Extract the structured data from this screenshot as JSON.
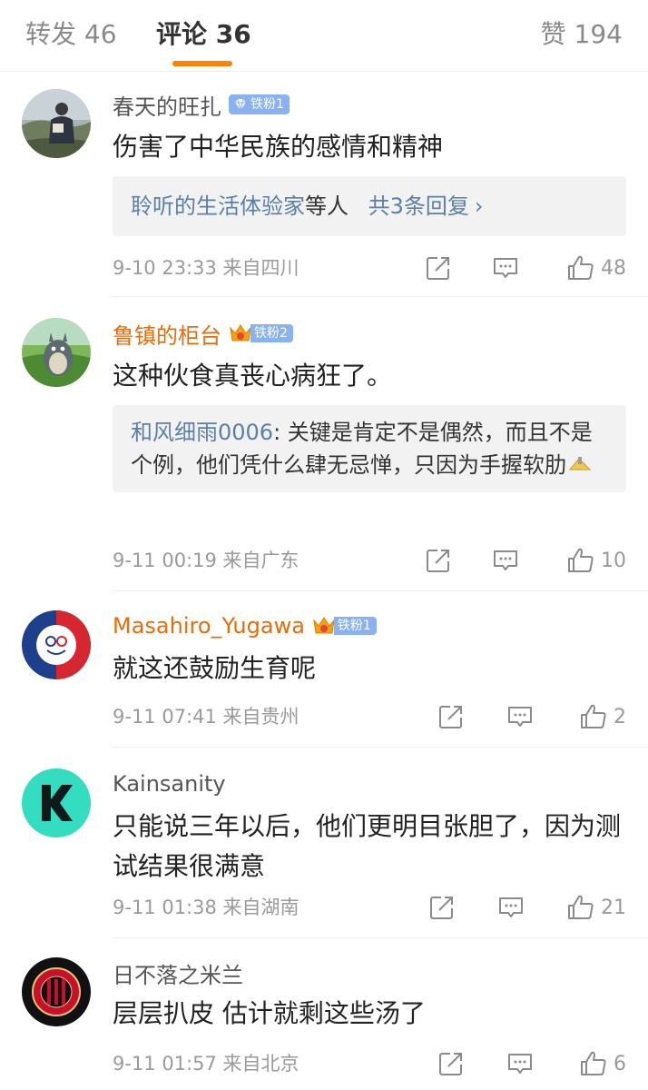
{
  "tabs": {
    "repost": "转发 46",
    "comments": "评论 36",
    "likes": "赞 194"
  },
  "colors": {
    "accent": "#ff8200",
    "link": "#5a7fa8",
    "vip_name": "#e86b0c",
    "badge": "#8ab2f0"
  },
  "comments": [
    {
      "username": "春天的旺扎",
      "badge": "铁粉1",
      "badge_icon": "diamond-icon",
      "text": "伤害了中华民族的感情和精神",
      "replies": {
        "names": "聆听的生活体验家",
        "others": "等人",
        "count": "共3条回复",
        "chevron": "›"
      },
      "time": "9-10 23:33 来自四川",
      "likes": "48"
    },
    {
      "username": "鲁镇的柜台",
      "badge": "铁粉2",
      "badge_icon": "crown-icon",
      "text": "这种伙食真丧心病狂了。",
      "quote": {
        "author": "和风细雨0006",
        "text": ": 关键是肯定不是偶然，而且不是个例，他们凭什么肆无忌惮，只因为手握软肋"
      },
      "time": "9-11 00:19 来自广东",
      "likes": "10"
    },
    {
      "username": "Masahiro_Yugawa",
      "badge": "铁粉1",
      "badge_icon": "crown-icon",
      "text": "就这还鼓励生育呢",
      "time": "9-11 07:41 来自贵州",
      "likes": "2"
    },
    {
      "username": "Kainsanity",
      "text": "只能说三年以后，他们更明目张胆了，因为测试结果很满意",
      "time": "9-11 01:38 来自湖南",
      "likes": "21"
    },
    {
      "username": "日不落之米兰",
      "text": "层层扒皮  估计就剩这些汤了",
      "time": "9-11 01:57 来自北京",
      "likes": "6"
    }
  ]
}
